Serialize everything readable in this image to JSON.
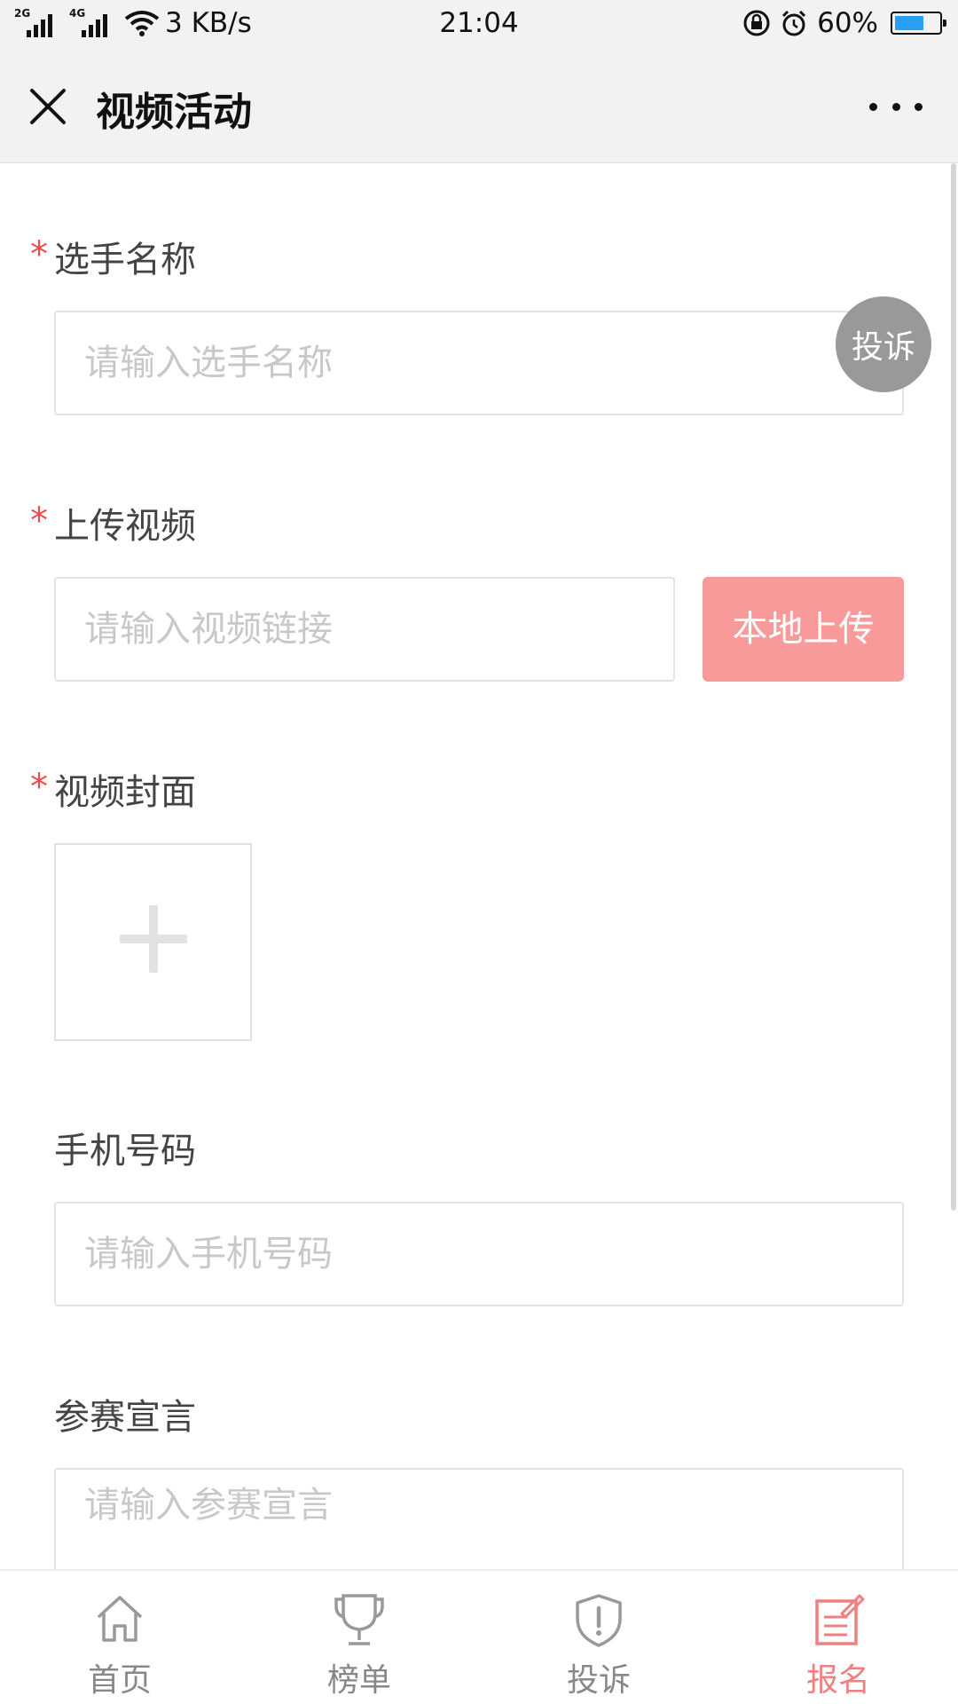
{
  "status_bar": {
    "gen1": "2G",
    "gen2": "4G",
    "speed": "3 KB/s",
    "time": "21:04",
    "battery": "60%"
  },
  "nav": {
    "title": "视频活动",
    "close_icon": "close-icon",
    "more_icon": "more-icon"
  },
  "form": {
    "player_name": {
      "label": "选手名称",
      "required_mark": "*",
      "placeholder": "请输入选手名称"
    },
    "video": {
      "label": "上传视频",
      "required_mark": "*",
      "placeholder": "请输入视频链接",
      "upload_button": "本地上传"
    },
    "cover": {
      "label": "视频封面",
      "required_mark": "*",
      "add_icon": "plus-icon"
    },
    "phone": {
      "label": "手机号码",
      "placeholder": "请输入手机号码"
    },
    "declaration": {
      "label": "参赛宣言",
      "placeholder": "请输入参赛宣言"
    }
  },
  "float_button": {
    "label": "投诉"
  },
  "tab_bar": {
    "items": [
      {
        "label": "首页",
        "icon": "home-icon",
        "active": false
      },
      {
        "label": "榜单",
        "icon": "trophy-icon",
        "active": false
      },
      {
        "label": "投诉",
        "icon": "shield-alert-icon",
        "active": false
      },
      {
        "label": "报名",
        "icon": "edit-form-icon",
        "active": true
      }
    ]
  },
  "colors": {
    "accent": "#f99a9a",
    "active_tab": "#f08080",
    "required": "#ef4b4b",
    "header_bg": "#f2f2f2"
  }
}
